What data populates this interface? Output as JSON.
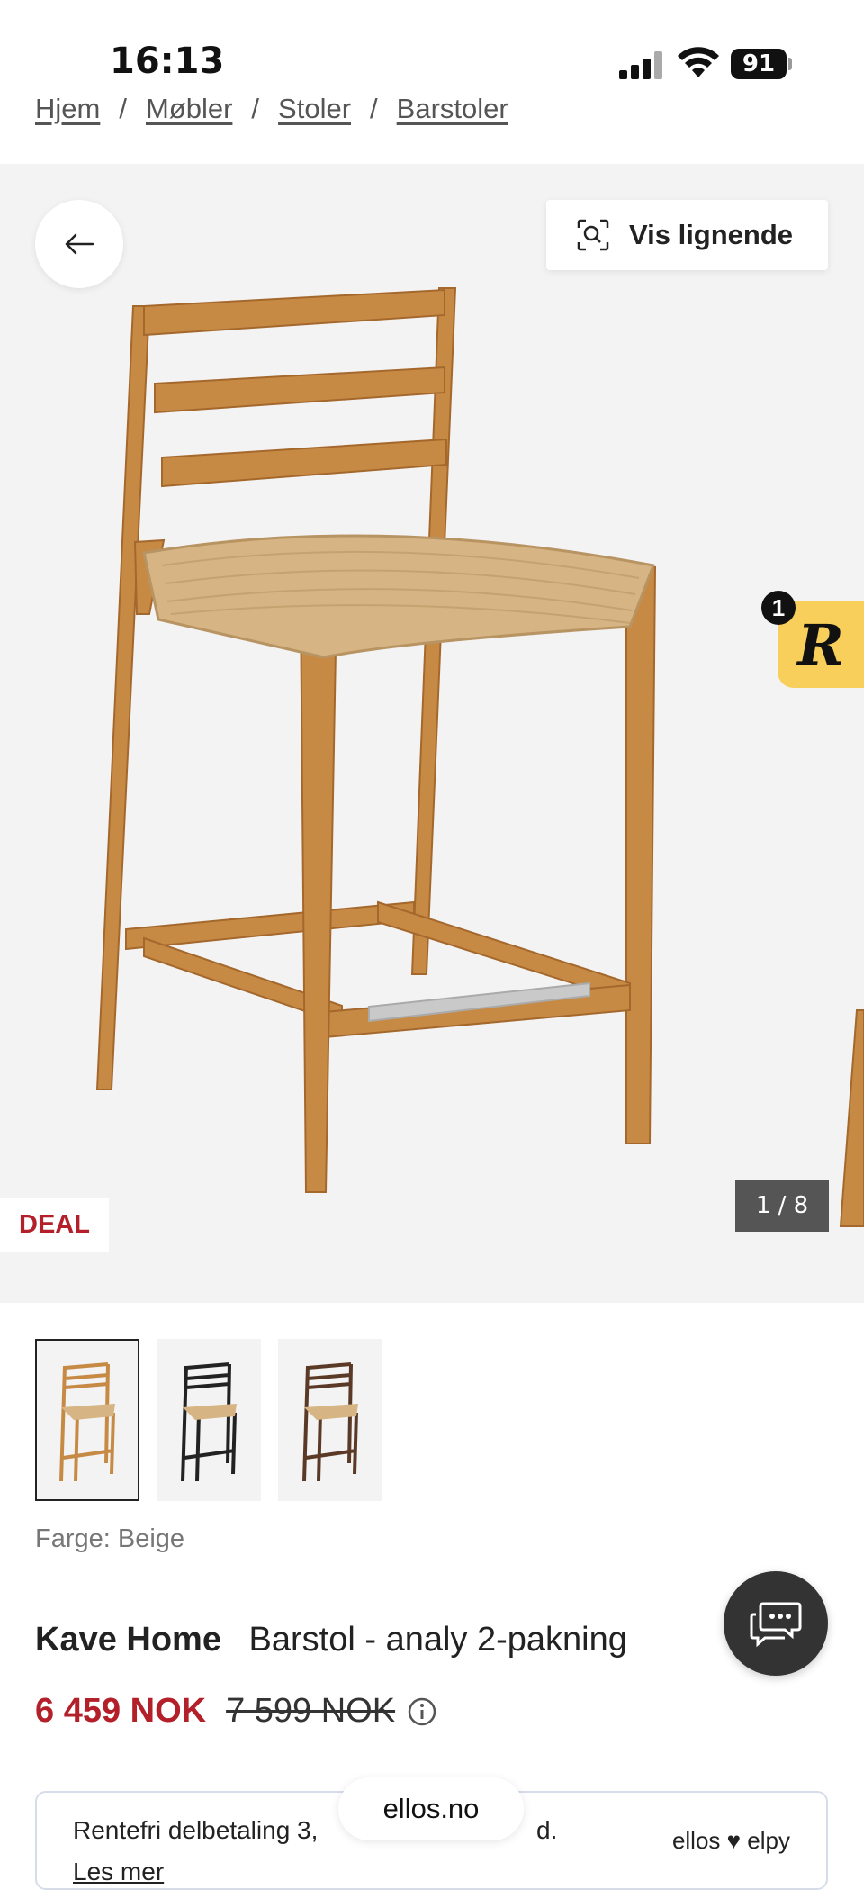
{
  "status": {
    "time": "16:13",
    "battery": "91"
  },
  "breadcrumb": [
    "Hjem",
    "Møbler",
    "Stoler",
    "Barstoler"
  ],
  "breadcrumb_sep": "/",
  "gallery": {
    "vis_lignende": "Vis lignende",
    "deal": "DEAL",
    "counter": "1 / 8",
    "r_badge": "R",
    "r_count": "1"
  },
  "color_label": "Farge: Beige",
  "product": {
    "brand": "Kave Home",
    "name": "Barstol - analy 2-pakning"
  },
  "price": {
    "now": "6 459 NOK",
    "old": "7 599 NOK"
  },
  "installment": {
    "text": "Rentefri delbetaling 3,",
    "text_end": "d.",
    "link": "Les mer",
    "logo": "ellos ♥ elpy"
  },
  "url": "ellos.no",
  "icons": [
    "back-arrow-icon",
    "visual-search-icon",
    "info-icon",
    "chat-icon",
    "signal-icon",
    "wifi-icon",
    "battery-icon"
  ]
}
